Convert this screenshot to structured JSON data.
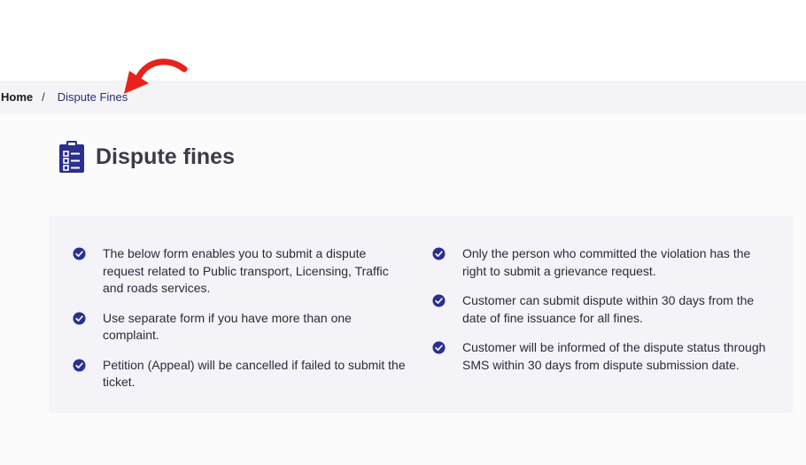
{
  "breadcrumb": {
    "home_label": "Home",
    "separator": "/",
    "current_label": "Dispute Fines"
  },
  "page": {
    "title": "Dispute fines",
    "icon": "clipboard-list-icon"
  },
  "info": {
    "left_items": [
      "The below form enables you to submit a dispute request related to Public transport, Licensing, Traffic and roads services.",
      "Use separate form if you have more than one complaint.",
      "Petition (Appeal) will be cancelled if failed to submit the ticket."
    ],
    "right_items": [
      "Only the person who committed the violation has the right to submit a grievance request.",
      "Customer can submit dispute within 30 days from the date of fine issuance for all fines.",
      "Customer will be informed of the dispute status through SMS within 30 days from dispute submission date."
    ]
  },
  "colors": {
    "accent": "#2b2f8f",
    "arrow": "#e8221b",
    "breadcrumb_bg": "#f4f4f6",
    "info_bg": "#f3f3f8"
  }
}
